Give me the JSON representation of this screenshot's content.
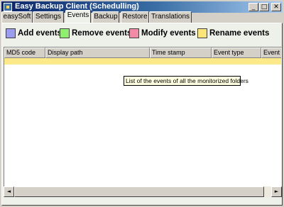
{
  "window": {
    "title": "Easy Backup Client (Schedulling)"
  },
  "titlebar_buttons": {
    "minimize": "_",
    "maximize": "□",
    "close": "✕"
  },
  "tabs": [
    {
      "label": "easySoft"
    },
    {
      "label": "Settings"
    },
    {
      "label": "Events",
      "active": true
    },
    {
      "label": "Backup"
    },
    {
      "label": "Restore"
    },
    {
      "label": "Translations"
    }
  ],
  "legend": [
    {
      "label": "Add events",
      "color": "#9c9cf0"
    },
    {
      "label": "Remove events",
      "color": "#8ef06c"
    },
    {
      "label": "Modify events",
      "color": "#f48aa6"
    },
    {
      "label": "Rename events",
      "color": "#fbe478"
    }
  ],
  "table": {
    "columns": [
      "MD5 code",
      "Display path",
      "Time stamp",
      "Event type",
      "Event d"
    ],
    "highlight_color": "#fbe98a"
  },
  "tooltip": {
    "text": "List of the events of all the monitorized folders"
  },
  "scrollbar": {
    "left_arrow": "◄",
    "right_arrow": "►"
  }
}
